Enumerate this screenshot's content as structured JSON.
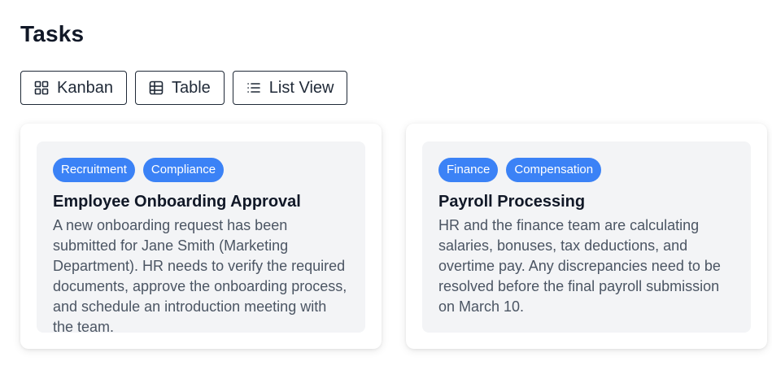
{
  "page": {
    "title": "Tasks"
  },
  "views": [
    {
      "label": "Kanban",
      "icon": "grid-icon"
    },
    {
      "label": "Table",
      "icon": "table-icon"
    },
    {
      "label": "List View",
      "icon": "list-icon"
    }
  ],
  "tasks": [
    {
      "tags": [
        "Recruitment",
        "Compliance"
      ],
      "title": "Employee Onboarding Approval",
      "description": "A new onboarding request has been submitted for Jane Smith (Marketing Department). HR needs to verify the required documents, approve the onboarding process, and schedule an introduction meeting with the team."
    },
    {
      "tags": [
        "Finance",
        "Compensation"
      ],
      "title": "Payroll Processing",
      "description": "HR and the finance team are calculating salaries, bonuses, tax deductions, and overtime pay. Any discrepancies need to be resolved before the final payroll submission on March 10."
    }
  ],
  "colors": {
    "tag": "#3b82f6",
    "card_inner": "#f3f4f6",
    "text": "#111827",
    "muted": "#4b5563"
  }
}
